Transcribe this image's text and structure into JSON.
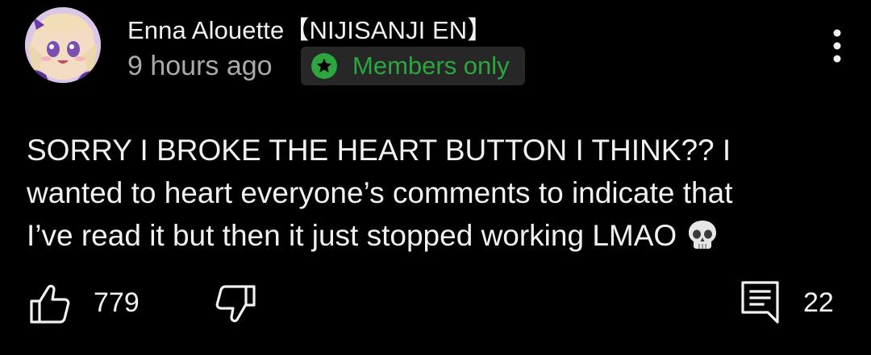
{
  "post": {
    "author": "Enna Alouette【NIJISANJI EN】",
    "timestamp": "9 hours ago",
    "badge": {
      "label": "Members only",
      "icon": "star-icon",
      "color": "#2ba640"
    },
    "menu_icon": "more-vert-icon",
    "text": "SORRY I BROKE THE HEART BUTTON I THINK?? I\nwanted to heart everyone’s comments to indicate that\nI’ve read it but then it just stopped working LMAO",
    "emoji": "skull-emoji"
  },
  "actions": {
    "like": {
      "icon": "thumbs-up-icon",
      "count": "779"
    },
    "dislike": {
      "icon": "thumbs-down-icon"
    },
    "comments": {
      "icon": "comment-icon",
      "count": "22"
    }
  },
  "colors": {
    "background": "#000000",
    "primary_text": "#f1f1f1",
    "secondary_text": "#aaaaaa",
    "badge_bg": "#272727"
  }
}
